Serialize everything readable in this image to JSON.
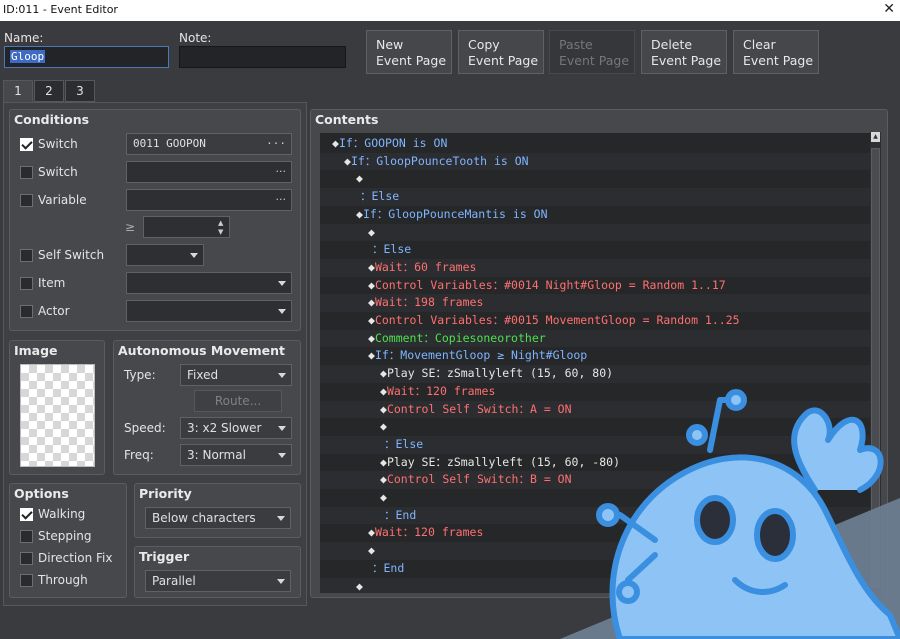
{
  "window": {
    "title": "ID:011 - Event Editor",
    "close_glyph": "✕"
  },
  "name": {
    "label": "Name:",
    "value": "Gloop"
  },
  "note": {
    "label": "Note:",
    "value": ""
  },
  "buttons": {
    "new": [
      "New",
      "Event Page"
    ],
    "copy": [
      "Copy",
      "Event Page"
    ],
    "paste": [
      "Paste",
      "Event Page"
    ],
    "delete": [
      "Delete",
      "Event Page"
    ],
    "clear": [
      "Clear",
      "Event Page"
    ]
  },
  "tabs": [
    "1",
    "2",
    "3"
  ],
  "conditions": {
    "title": "Conditions",
    "switch1": {
      "label": "Switch",
      "checked": true,
      "value": "0011 GOOPON"
    },
    "switch2": {
      "label": "Switch",
      "checked": false,
      "value": ""
    },
    "variable": {
      "label": "Variable",
      "checked": false,
      "value": "",
      "ge": "≥",
      "number": ""
    },
    "self_switch": {
      "label": "Self Switch",
      "checked": false,
      "value": ""
    },
    "item": {
      "label": "Item",
      "checked": false,
      "value": ""
    },
    "actor": {
      "label": "Actor",
      "checked": false,
      "value": ""
    },
    "dots": "···"
  },
  "image": {
    "title": "Image"
  },
  "movement": {
    "title": "Autonomous Movement",
    "type_label": "Type:",
    "type_value": "Fixed",
    "route_label": "Route...",
    "speed_label": "Speed:",
    "speed_value": "3: x2 Slower",
    "freq_label": "Freq:",
    "freq_value": "3: Normal"
  },
  "options": {
    "title": "Options",
    "walking": {
      "label": "Walking",
      "checked": true
    },
    "stepping": {
      "label": "Stepping",
      "checked": false
    },
    "direction_fix": {
      "label": "Direction Fix",
      "checked": false
    },
    "through": {
      "label": "Through",
      "checked": false
    }
  },
  "priority": {
    "title": "Priority",
    "value": "Below characters"
  },
  "trigger": {
    "title": "Trigger",
    "value": "Parallel"
  },
  "contents": {
    "title": "Contents",
    "lines": [
      {
        "indent": 0,
        "text": "If：GOOPON is ON",
        "color": "blue"
      },
      {
        "indent": 1,
        "text": "If：GloopPounceTooth is ON",
        "color": "blue"
      },
      {
        "indent": 2,
        "text": "",
        "color": "white"
      },
      {
        "indent": 1,
        "text": "：Else",
        "color": "blue",
        "nodiamond": true
      },
      {
        "indent": 2,
        "text": "If：GloopPounceMantis is ON",
        "color": "blue"
      },
      {
        "indent": 3,
        "text": "",
        "color": "white"
      },
      {
        "indent": 2,
        "text": "：Else",
        "color": "blue",
        "nodiamond": true
      },
      {
        "indent": 3,
        "text": "Wait：60 frames",
        "color": "red"
      },
      {
        "indent": 3,
        "text": "Control Variables：#0014 Night#Gloop = Random 1..17",
        "color": "red"
      },
      {
        "indent": 3,
        "text": "Wait：198 frames",
        "color": "red"
      },
      {
        "indent": 3,
        "text": "Control Variables：#0015 MovementGloop = Random 1..25",
        "color": "red"
      },
      {
        "indent": 3,
        "text": "Comment：Copiesoneorother",
        "color": "green"
      },
      {
        "indent": 3,
        "text": "If：MovementGloop ≥ Night#Gloop",
        "color": "blue"
      },
      {
        "indent": 4,
        "text": "Play SE：zSmallyleft (15, 60, 80)",
        "color": "white"
      },
      {
        "indent": 4,
        "text": "Wait：120 frames",
        "color": "red"
      },
      {
        "indent": 4,
        "text": "Control Self Switch：A = ON",
        "color": "red"
      },
      {
        "indent": 4,
        "text": "",
        "color": "white"
      },
      {
        "indent": 3,
        "text": "：Else",
        "color": "blue",
        "nodiamond": true
      },
      {
        "indent": 4,
        "text": "Play SE：zSmallyleft (15, 60, -80)",
        "color": "white"
      },
      {
        "indent": 4,
        "text": "Control Self Switch：B = ON",
        "color": "red"
      },
      {
        "indent": 4,
        "text": "",
        "color": "white"
      },
      {
        "indent": 3,
        "text": "：End",
        "color": "blue",
        "nodiamond": true
      },
      {
        "indent": 3,
        "text": "Wait：120 frames",
        "color": "red"
      },
      {
        "indent": 3,
        "text": "",
        "color": "white"
      },
      {
        "indent": 2,
        "text": "：End",
        "color": "blue",
        "nodiamond": true
      },
      {
        "indent": 2,
        "text": "",
        "color": "white"
      }
    ]
  },
  "mascot": {
    "description_icon": "ghost-mascot-icon",
    "stroke": "#3b8fe0",
    "fill": "#8ec4f5",
    "band": "#6d7d91"
  }
}
